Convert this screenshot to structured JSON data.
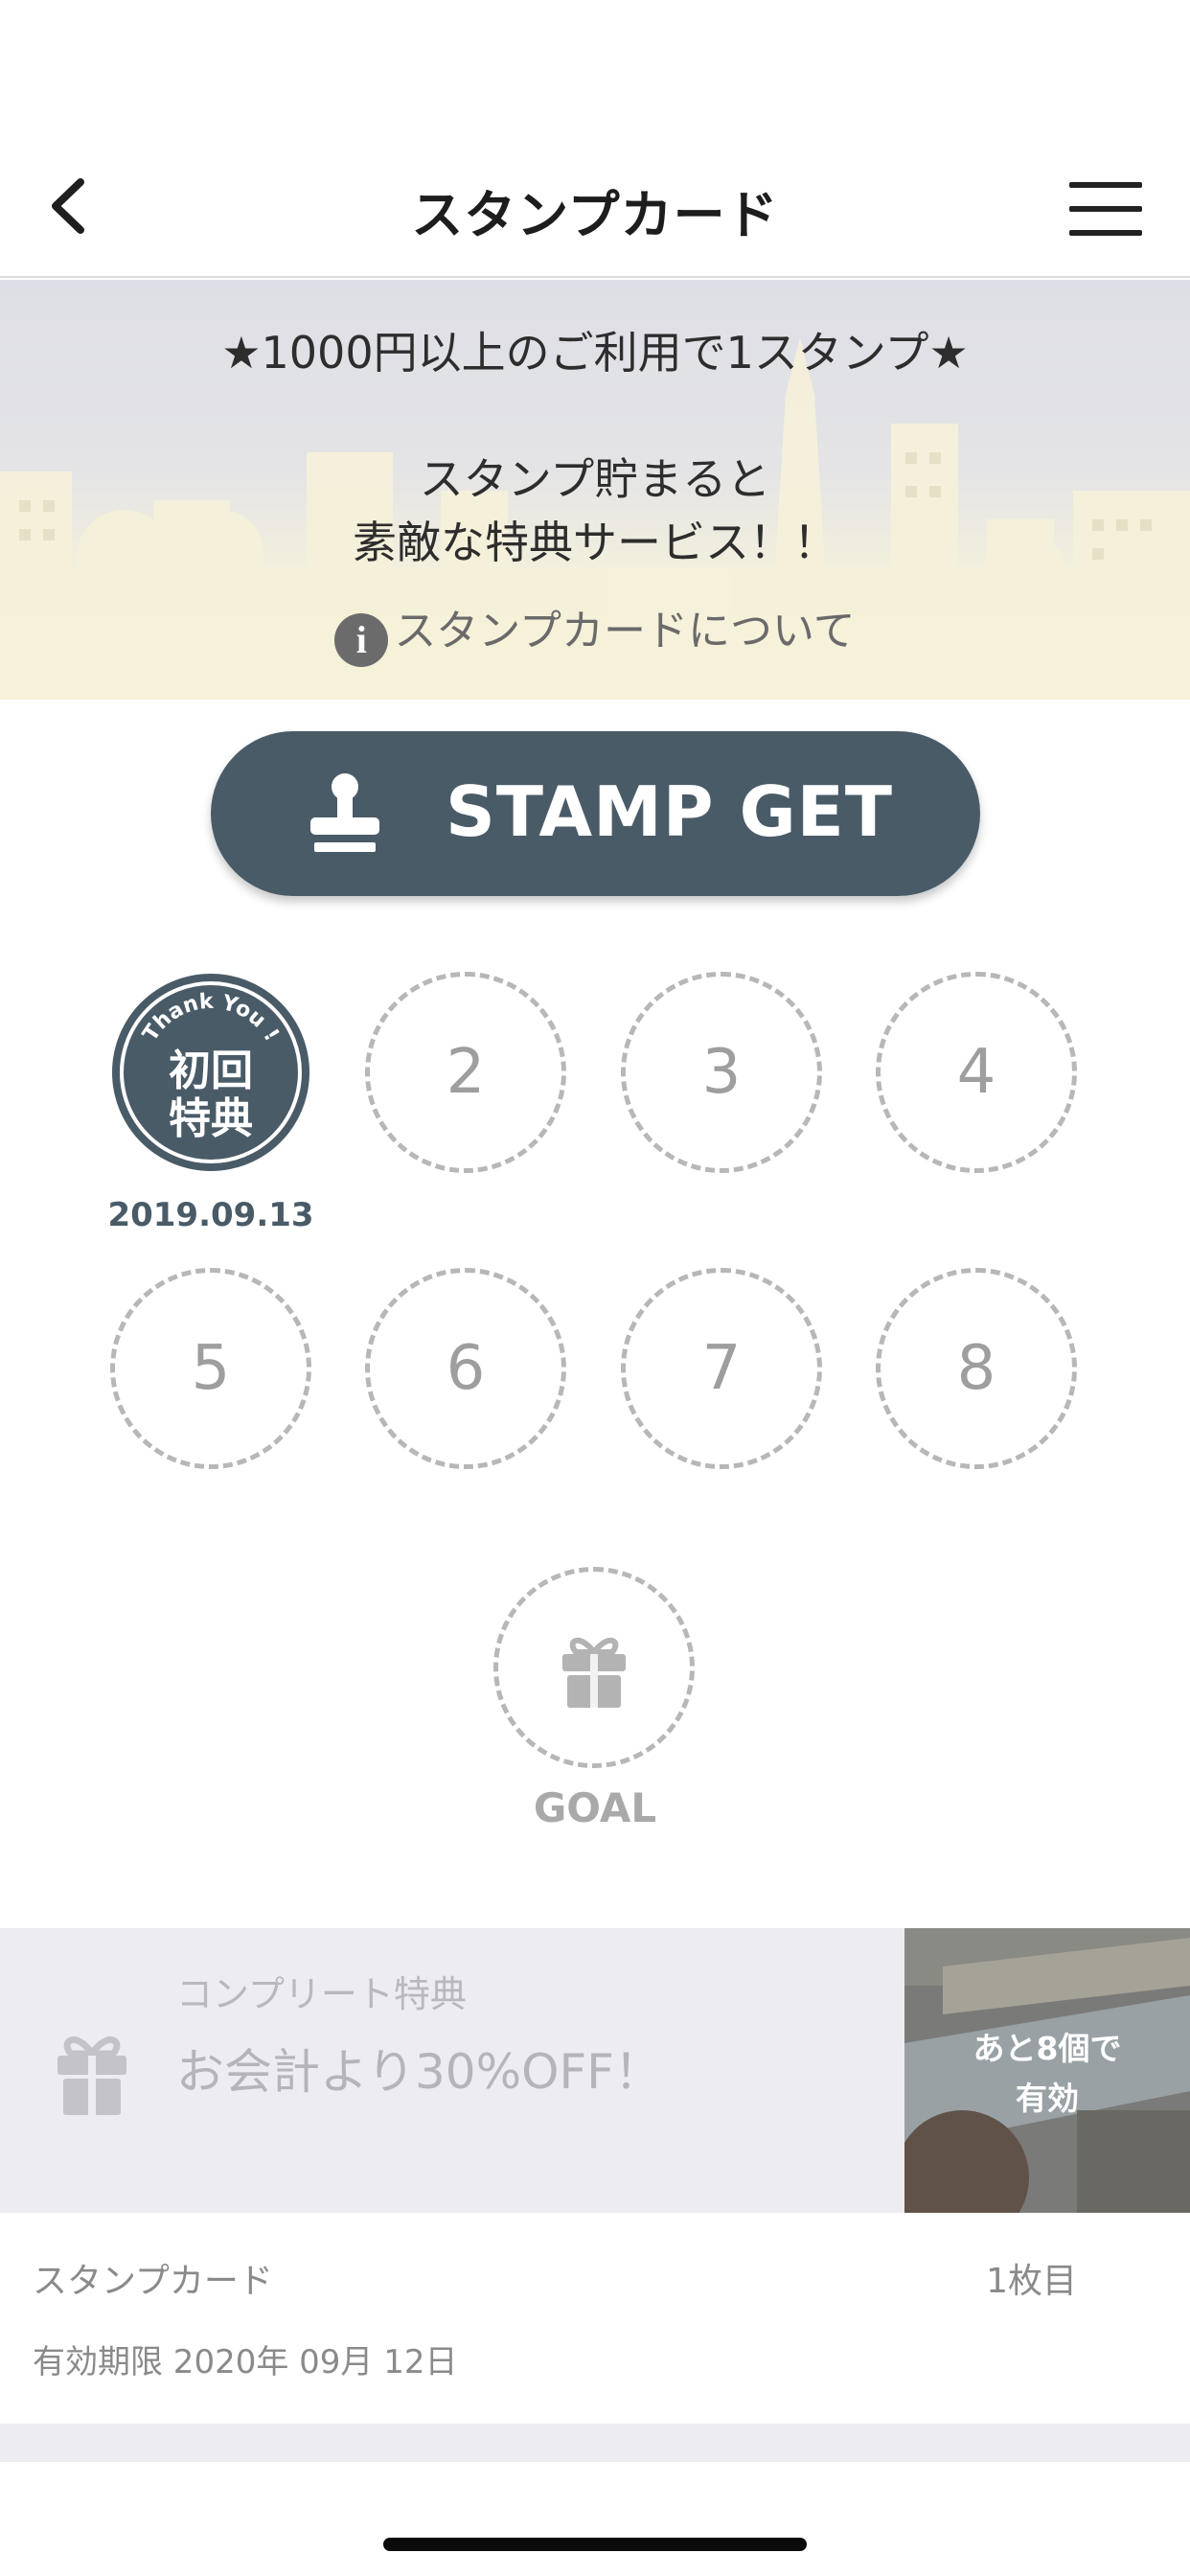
{
  "nav": {
    "title": "スタンプカード",
    "back_icon": "chevron-left-icon",
    "menu_icon": "hamburger-menu-icon"
  },
  "banner": {
    "line1": "★1000円以上のご利用で1スタンプ★",
    "line2": "スタンプ貯まると",
    "line3": "素敵な特典サービス！！",
    "about_link": "スタンプカードについて",
    "info_icon_text": "i"
  },
  "stamp_button": {
    "label": "STAMP GET",
    "icon": "stamper-icon"
  },
  "stamps": {
    "first": {
      "badge_top": "Thank You !",
      "badge_line1": "初回",
      "badge_line2": "特典",
      "date": "2019.09.13"
    },
    "slots": [
      "2",
      "3",
      "4",
      "5",
      "6",
      "7",
      "8"
    ],
    "goal": {
      "label": "GOAL",
      "icon": "gift-icon"
    }
  },
  "complete_reward": {
    "caption": "コンプリート特典",
    "offer": "お会計より30%OFF！",
    "remaining_line1": "あと8個で",
    "remaining_line2": "有効"
  },
  "card_info": {
    "name": "スタンプカード",
    "number": "1枚目",
    "expiry": "有効期限 2020年 09月 12日"
  },
  "colors": {
    "accent": "#4a5b68",
    "dashed": "#b7b7b7",
    "reward_bg": "#ececf1"
  }
}
